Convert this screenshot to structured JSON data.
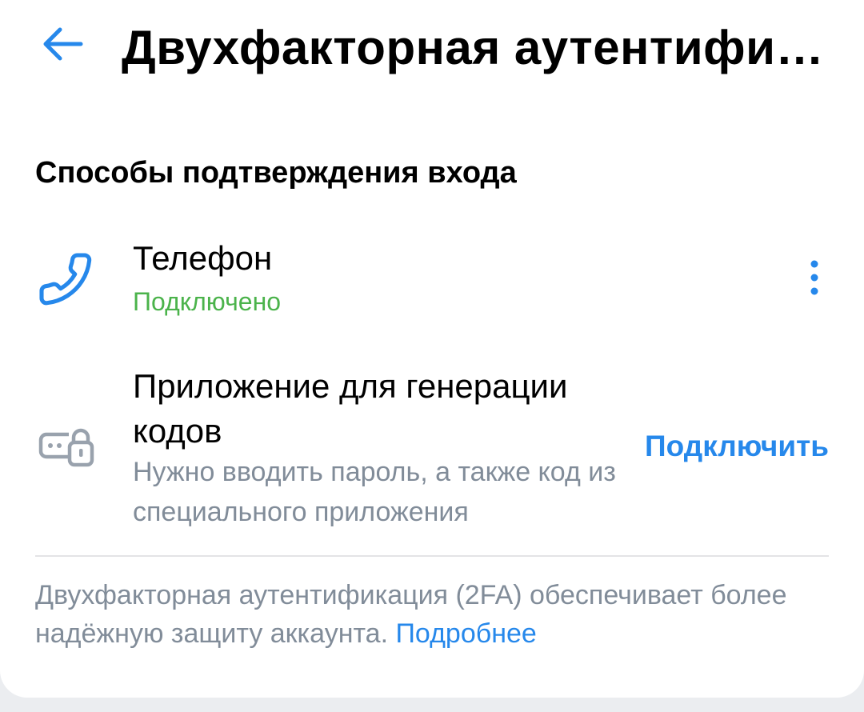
{
  "header": {
    "title": "Двухфакторная аутентифик…",
    "back_icon": "arrow-left-icon"
  },
  "section": {
    "title": "Способы подтверждения входа"
  },
  "methods": [
    {
      "icon": "phone-icon",
      "title": "Телефон",
      "status": "Подключено",
      "action_icon": "more-vertical-icon"
    },
    {
      "icon": "app-code-lock-icon",
      "title": "Приложение для генерации кодов",
      "description": "Нужно вводить пароль, а также код из специального приложения",
      "action_label": "Подключить"
    }
  ],
  "footer": {
    "text": "Двухфакторная аутентификация (2FA) обеспечивает более надёжную защиту аккаунта.",
    "link": "Подробнее"
  },
  "colors": {
    "accent": "#2688eb",
    "success": "#4bb34b",
    "secondary_text": "#818c99",
    "icon_gray": "#99a2ad",
    "background": "#ebedf0",
    "card": "#ffffff"
  }
}
